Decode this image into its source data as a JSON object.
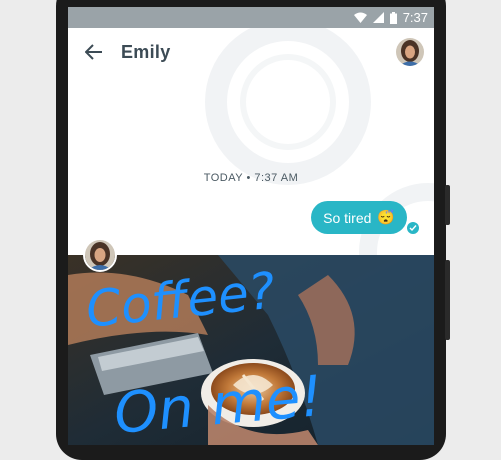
{
  "status_bar": {
    "time": "7:37"
  },
  "header": {
    "contact_name": "Emily"
  },
  "conversation": {
    "timestamp": "TODAY • 7:37 AM",
    "message_text": "So tired",
    "message_emoji": "😴"
  },
  "photo": {
    "handwriting_line1": "Coffee?",
    "handwriting_line2": "On me!"
  },
  "colors": {
    "accent": "#29b6c6",
    "status_bar": "#9aa3a8",
    "title": "#3c4b55",
    "ink": "#1e90ff"
  },
  "icons": {
    "back": "arrow-left-icon",
    "wifi": "wifi-icon",
    "signal": "signal-icon",
    "battery": "battery-icon",
    "read_receipt": "checkmark-icon"
  }
}
